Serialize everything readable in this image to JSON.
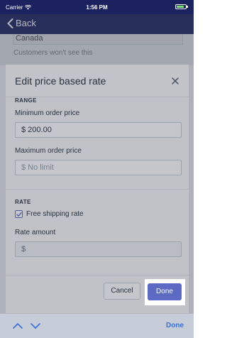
{
  "status_bar": {
    "carrier": "Carrier",
    "time": "1:56 PM"
  },
  "nav": {
    "back_label": "Back"
  },
  "background": {
    "field_value": "Canada",
    "hint": "Customers won't see this"
  },
  "modal": {
    "title": "Edit price based rate",
    "range": {
      "section_title": "RANGE",
      "min_label": "Minimum order price",
      "min_value": "$ 200.00",
      "max_label": "Maximum order price",
      "max_placeholder": "$ No limit"
    },
    "rate": {
      "section_title": "RATE",
      "free_shipping_label": "Free shipping rate",
      "free_shipping_checked": true,
      "amount_label": "Rate amount",
      "amount_value": "$"
    },
    "footer": {
      "cancel_label": "Cancel",
      "done_label": "Done"
    }
  },
  "accessory_bar": {
    "done_label": "Done"
  },
  "colors": {
    "nav_bg": "#1c2260",
    "primary": "#5c6ac4",
    "accessory_done": "#3a6fd8"
  }
}
